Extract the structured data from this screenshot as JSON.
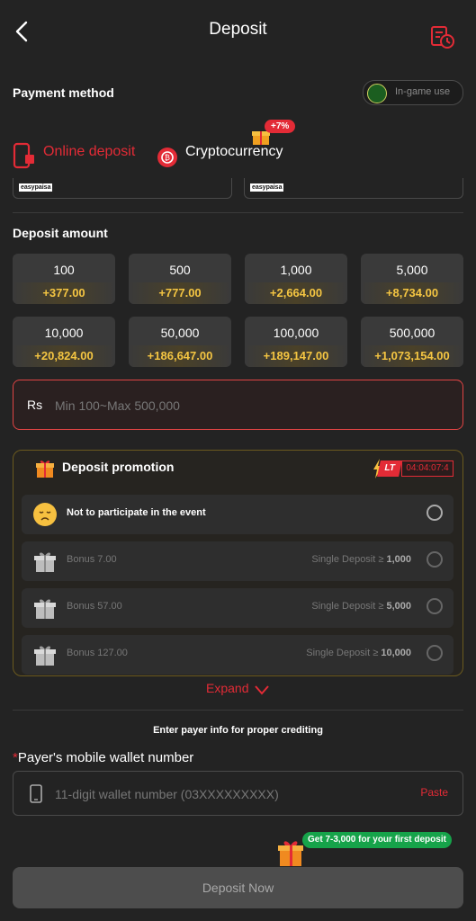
{
  "header": {
    "title": "Deposit"
  },
  "payment_method": {
    "label": "Payment method",
    "in_game_use": "In-game use"
  },
  "tabs": [
    {
      "label": "Online deposit",
      "active": true
    },
    {
      "label": "Cryptocurrency",
      "active": false,
      "badge": "+7%"
    }
  ],
  "methods": [
    {
      "logo": "easypaisa"
    },
    {
      "logo": "easypaisa"
    }
  ],
  "deposit_amount": {
    "label": "Deposit amount",
    "options": [
      {
        "amount": "100",
        "bonus": "+377.00"
      },
      {
        "amount": "500",
        "bonus": "+777.00"
      },
      {
        "amount": "1,000",
        "bonus": "+2,664.00"
      },
      {
        "amount": "5,000",
        "bonus": "+8,734.00"
      },
      {
        "amount": "10,000",
        "bonus": "+20,824.00"
      },
      {
        "amount": "50,000",
        "bonus": "+186,647.00"
      },
      {
        "amount": "100,000",
        "bonus": "+189,147.00"
      },
      {
        "amount": "500,000",
        "bonus": "+1,073,154.00"
      }
    ],
    "currency": "Rs",
    "placeholder": "Min 100~Max 500,000"
  },
  "promotion": {
    "title": "Deposit promotion",
    "timer_tag": "LT",
    "timer": "04:04:07:4",
    "options": [
      {
        "label": "Not to participate in the event",
        "condition_prefix": "",
        "condition_value": ""
      },
      {
        "label": "Bonus 7.00",
        "condition_prefix": "Single Deposit ≥ ",
        "condition_value": "1,000"
      },
      {
        "label": "Bonus 57.00",
        "condition_prefix": "Single Deposit ≥ ",
        "condition_value": "5,000"
      },
      {
        "label": "Bonus 127.00",
        "condition_prefix": "Single Deposit ≥ ",
        "condition_value": "10,000"
      }
    ],
    "expand_label": "Expand"
  },
  "payer": {
    "note": "Enter payer info for proper crediting",
    "wallet_label": "Payer's mobile wallet number",
    "wallet_placeholder": "11-digit wallet number (03XXXXXXXXX)",
    "paste_label": "Paste"
  },
  "first_deposit_badge": "Get 7-3,000 for your first deposit",
  "deposit_button": "Deposit Now",
  "colors": {
    "accent": "#e32b36",
    "gold": "#f4c542",
    "bg": "#232323",
    "green": "#16a34a"
  }
}
